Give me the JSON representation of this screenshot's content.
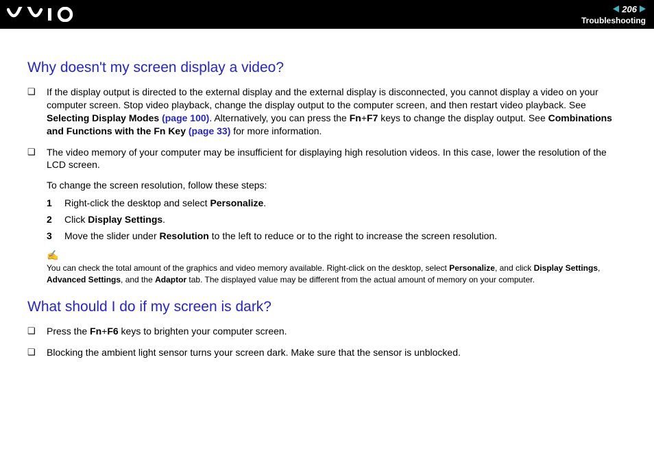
{
  "header": {
    "page_number": "206",
    "section": "Troubleshooting"
  },
  "section1": {
    "heading": "Why doesn't my screen display a video?",
    "b1_pre": "If the display output is directed to the external display and the external display is disconnected, you cannot display a video on your computer screen. Stop video playback, change the display output to the computer screen, and then restart video playback. See ",
    "b1_bold1": "Selecting Display Modes ",
    "b1_link1": "(page 100)",
    "b1_mid": ". Alternatively, you can press the ",
    "b1_bold2": "Fn",
    "b1_plus": "+",
    "b1_bold3": "F7",
    "b1_mid2": " keys to change the display output. See ",
    "b1_bold4": "Combinations and Functions with the Fn Key ",
    "b1_link2": "(page 33)",
    "b1_end": " for more information.",
    "b2": "The video memory of your computer may be insufficient for displaying high resolution videos. In this case, lower the resolution of the LCD screen.",
    "sub_intro": "To change the screen resolution, follow these steps:",
    "step1_pre": "Right-click the desktop and select ",
    "step1_bold": "Personalize",
    "step1_post": ".",
    "step2_pre": "Click ",
    "step2_bold": "Display Settings",
    "step2_post": ".",
    "step3_pre": "Move the slider under ",
    "step3_bold": "Resolution",
    "step3_post": " to the left to reduce or to the right to increase the screen resolution.",
    "note_icon": "✍",
    "note_pre": "You can check the total amount of the graphics and video memory available. Right-click on the desktop, select ",
    "note_b1": "Personalize",
    "note_m1": ", and click ",
    "note_b2": "Display Settings",
    "note_m2": ", ",
    "note_b3": "Advanced Settings",
    "note_m3": ", and the ",
    "note_b4": "Adaptor",
    "note_end": " tab. The displayed value may be different from the actual amount of memory on your computer."
  },
  "section2": {
    "heading": "What should I do if my screen is dark?",
    "b1_pre": "Press the ",
    "b1_bold1": "Fn",
    "b1_plus": "+",
    "b1_bold2": "F6",
    "b1_post": " keys to brighten your computer screen.",
    "b2": "Blocking the ambient light sensor turns your screen dark. Make sure that the sensor is unblocked."
  }
}
